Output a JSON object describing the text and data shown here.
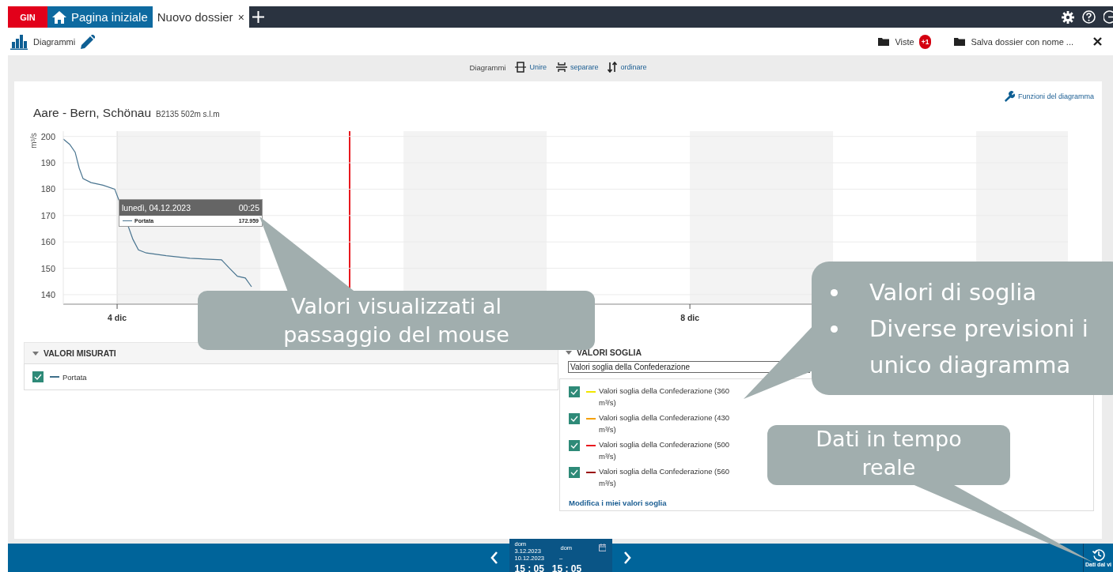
{
  "tabs": [
    {
      "label": "GIN",
      "kind": "brand",
      "selected": false
    },
    {
      "label": "Pagina iniziale",
      "kind": "home",
      "selected": false
    },
    {
      "label": "Nuovo dossier",
      "kind": "dossier",
      "selected": true,
      "close": "×"
    }
  ],
  "toolbar": {
    "title": "Diagrammi",
    "views": {
      "label": "Viste",
      "badge": "+1"
    },
    "save": "Salva dossier con nome ..."
  },
  "chart_toolbar": {
    "label": "Diagrammi",
    "actions": [
      {
        "label": "Unire",
        "kind": "merge"
      },
      {
        "label": "separare",
        "kind": "split"
      },
      {
        "label": "ordinare",
        "kind": "sort"
      }
    ]
  },
  "diagram": {
    "functions_link": "Funzioni del diagramma",
    "station": "Aare - Bern, Schönau",
    "station_meta": "B2135 502m  s.l.m",
    "chart_data": {
      "type": "line",
      "ylabel": "m³/s",
      "x": [
        3.624,
        3.669,
        3.707,
        3.735,
        3.762,
        3.818,
        3.901,
        3.983,
        4.011,
        4.11,
        4.149,
        4.204,
        4.343,
        4.508,
        4.729,
        4.785,
        4.84,
        4.895,
        4.939
      ],
      "series": [
        {
          "name": "Portata",
          "color": "#4a7590",
          "values": [
            199,
            197,
            194,
            188,
            184,
            182.5,
            181.5,
            180,
            176,
            161,
            157,
            155.8,
            154.8,
            153.8,
            153.2,
            150,
            147,
            146.3,
            143
          ]
        }
      ],
      "xlim": [
        3.624,
        10.64
      ],
      "ylim": [
        136.4,
        202
      ],
      "xticks": [
        {
          "value": 4,
          "label": "4 dic"
        },
        {
          "value": 8,
          "label": "8 dic"
        }
      ],
      "yticks": [
        140,
        150,
        160,
        170,
        180,
        190,
        200
      ],
      "grid": true
    },
    "tooltip": {
      "date": "lunedì, 04.12.2023",
      "time": "00:25",
      "value": "172.959"
    }
  },
  "measured": {
    "title": "VALORI MISURATI",
    "items": [
      {
        "label": "Portata",
        "checked": true,
        "color": "#3f6f8a"
      }
    ]
  },
  "thresholds": {
    "title": "VALORI SOGLIA",
    "select": "Valori soglia della Confederazione",
    "items": [
      {
        "label": "Valori soglia della Confederazione (360 m³/s)",
        "checked": true,
        "color": "#f2e600"
      },
      {
        "label": "Valori soglia della Confederazione (430 m³/s)",
        "checked": true,
        "color": "#f5a000"
      },
      {
        "label": "Valori soglia della Confederazione (500 m³/s)",
        "checked": true,
        "color": "#e8191f"
      },
      {
        "label": "Valori soglia della Confederazione (560 m³/s)",
        "checked": true,
        "color": "#9b0d0d"
      }
    ],
    "edit_link": "Modifica i miei valori soglia"
  },
  "timebar": {
    "start": "dom 3.12.2023",
    "end_day": "dom",
    "end_date": "10.12.2023",
    "separator": "–",
    "start_time": "15 : 05",
    "end_time": "15 : 05",
    "realtime": "Dati dal vi"
  },
  "callouts": [
    {
      "kind": "plain",
      "lines": [
        "Valori visualizzati al",
        "passaggio del mouse"
      ]
    },
    {
      "kind": "bulleted",
      "items": [
        {
          "lines": [
            "Valori di soglia"
          ]
        },
        {
          "lines": [
            "Diverse previsioni i",
            "unico diagramma"
          ]
        }
      ]
    },
    {
      "kind": "plain",
      "lines": [
        "Dati in tempo",
        "reale"
      ]
    }
  ]
}
